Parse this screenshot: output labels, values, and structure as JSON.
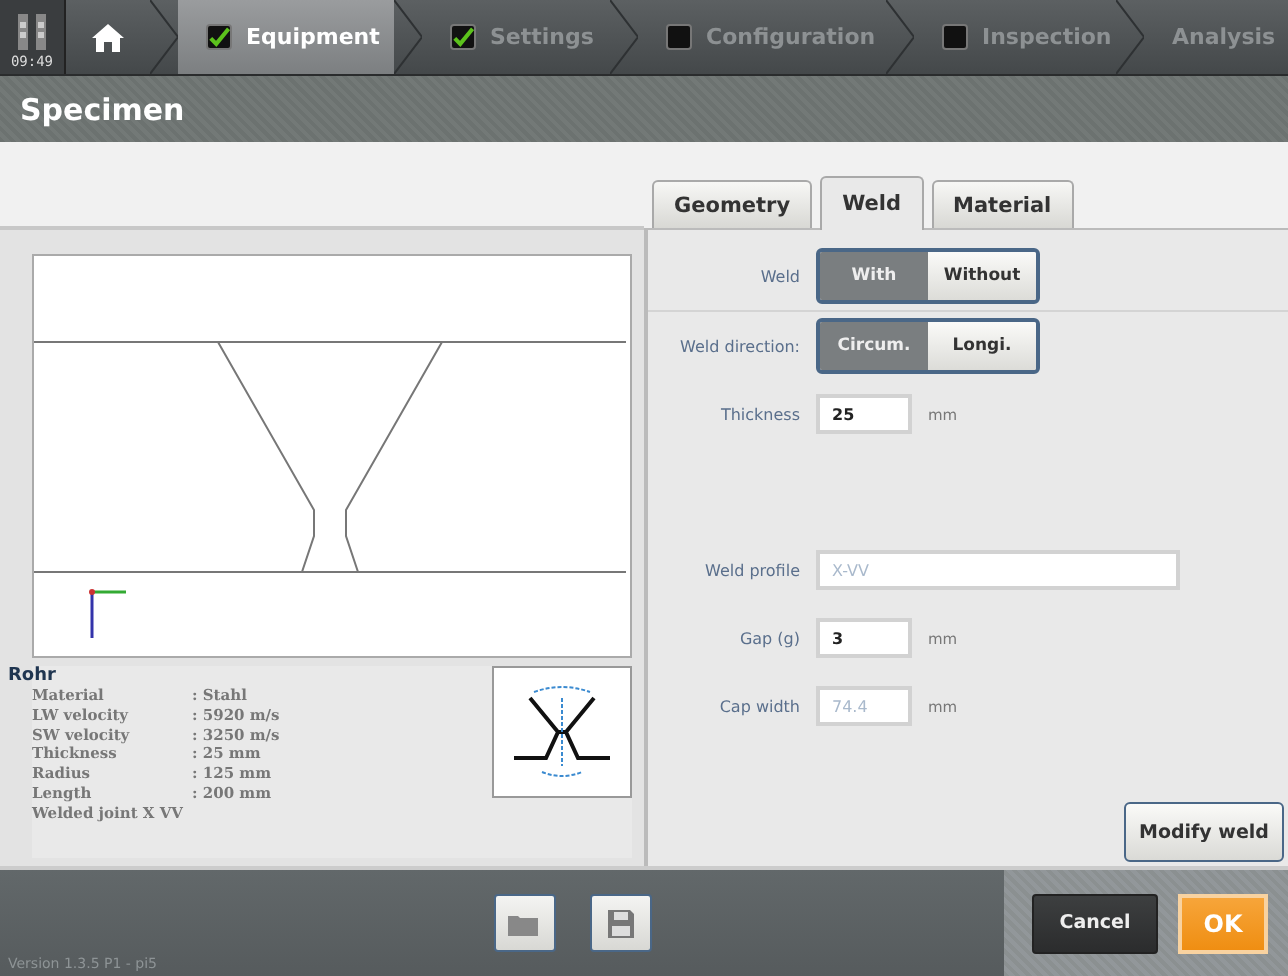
{
  "status": {
    "time": "09:49"
  },
  "steps": [
    {
      "kind": "home",
      "selected": false
    },
    {
      "kind": "step",
      "label": "Equipment",
      "checked": true,
      "selected": true
    },
    {
      "kind": "step",
      "label": "Settings",
      "checked": true,
      "selected": false
    },
    {
      "kind": "step",
      "label": "Configuration",
      "checked": false,
      "selected": false
    },
    {
      "kind": "step",
      "label": "Inspection",
      "checked": false,
      "selected": false
    },
    {
      "kind": "plain",
      "label": "Analysis",
      "selected": false
    }
  ],
  "header": {
    "title": "Specimen"
  },
  "tabs": [
    {
      "label": "Geometry",
      "selected": false
    },
    {
      "label": "Weld",
      "selected": true
    },
    {
      "label": "Material",
      "selected": false
    }
  ],
  "weld_settings": [
    {
      "kind": "toggle",
      "label": "Weld",
      "options": [
        {
          "label": "With",
          "selected": true
        },
        {
          "label": "Without",
          "selected": false
        }
      ]
    },
    {
      "kind": "toggle",
      "label": "Weld direction:",
      "options": [
        {
          "label": "Circum.",
          "selected": true
        },
        {
          "label": "Longi.",
          "selected": false
        }
      ]
    },
    {
      "kind": "number",
      "label": "Thickness",
      "value": "25",
      "unit": "mm",
      "disabled": false
    }
  ],
  "profile_settings": [
    {
      "kind": "text",
      "label": "Weld profile",
      "value": "X-VV",
      "disabled": true
    },
    {
      "kind": "number",
      "label": "Gap (g)",
      "value": "3",
      "unit": "mm",
      "disabled": false
    },
    {
      "kind": "number",
      "label": "Cap width",
      "value": "74.4",
      "unit": "mm",
      "disabled": true
    }
  ],
  "info": {
    "title": "Rohr",
    "properties": [
      {
        "name": "Material",
        "value": ": Stahl"
      },
      {
        "name": "LW velocity",
        "value": ": 5920 m/s"
      },
      {
        "name": "SW velocity",
        "value": ": 3250 m/s"
      },
      {
        "name": "Thickness",
        "value": ": 25 mm"
      },
      {
        "name": "Radius",
        "value": ": 125 mm"
      },
      {
        "name": "Length",
        "value": ": 200 mm"
      }
    ],
    "footer": "Welded joint X VV"
  },
  "modify_button": "Modify weld",
  "footer": {
    "version": "Version 1.3.5 P1 - pi5",
    "cancel": "Cancel",
    "ok": "OK"
  }
}
